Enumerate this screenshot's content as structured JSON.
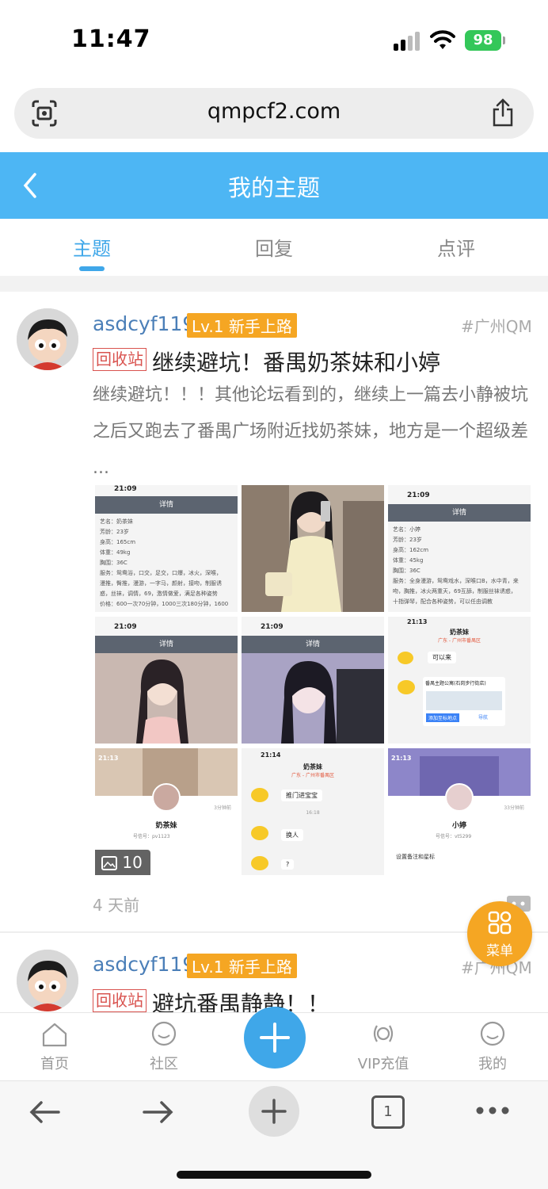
{
  "status": {
    "time": "11:47",
    "battery": "98"
  },
  "browser": {
    "url": "qmpcf2.com"
  },
  "header": {
    "title": "我的主题"
  },
  "tabs": [
    {
      "label": "主题"
    },
    {
      "label": "回复"
    },
    {
      "label": "点评"
    }
  ],
  "posts": [
    {
      "username": "asdcyf119",
      "level": "Lv.1 新手上路",
      "tag": "#广州QM",
      "category": "回收站",
      "title": "继续避坑！番禺奶茶妹和小婷",
      "excerpt": "继续避坑！！！其他论坛看到的，继续上一篇去小静被坑之后又跑去了番禺广场附近找奶茶妹，地方是一个超级差 ...",
      "image_count": "10",
      "time": "4 天前"
    },
    {
      "username": "asdcyf119",
      "level": "Lv.1 新手上路",
      "tag": "#广州QM",
      "category": "回收站",
      "title": "避坑番禺静静！！"
    }
  ],
  "images": {
    "img1": {
      "time": "21:09",
      "title": "详情",
      "lines": [
        "艺名：奶茶妹",
        "芳龄：23岁",
        "身高：165cm",
        "体重：49kg",
        "胸围：36C",
        "服务：鸳鸯浴，口交，足交，口爆，冰火，深喉，",
        "漫推，臀推，漫游，一字马，颜射，接吻，制服诱",
        "惑，丝袜，调情，69，激情做爱，满足各种姿势",
        "价格：600一次70分钟，1000三次180分钟，1600"
      ]
    },
    "img3": {
      "time": "21:09",
      "title": "详情",
      "lines": [
        "艺名：小婷",
        "芳龄：23岁",
        "身高：162cm",
        "体重：45kg",
        "胸围：36C",
        "服务：全身漫游，鸳鸯戏水，深喉口B，水中青，来",
        "吻，胸推，冰火两重天，69互舔，制服丝袜诱惑，",
        "十指弹琴，配合各种姿势，可以任由调教"
      ]
    },
    "img4": {
      "time": "21:09",
      "title": "详情"
    },
    "img5": {
      "time": "21:09",
      "title": "详情"
    },
    "img6": {
      "time": "21:13",
      "name": "奶茶妹",
      "loc": "广东 - 广州市番禺区",
      "msg": "可以来",
      "map": "番禺主题公寓(石岗步行街店)",
      "map_btn": "添加至标地点",
      "nav_btn": "导航"
    },
    "img7": {
      "time": "21:13",
      "name": "奶茶妹",
      "time_ago": "3分钟前",
      "id": "号信号：pv1123"
    },
    "img8": {
      "time": "21:14",
      "name": "奶茶妹",
      "loc": "广东 - 广州市番禺区",
      "msgs": [
        "推门进宝宝",
        "换人",
        "?"
      ],
      "stamp": "16:18"
    },
    "img9": {
      "time": "21:13",
      "name": "小婷",
      "time_ago": "33分钟前",
      "id": "号信号：vt5299",
      "setting": "设置备注和星标"
    }
  },
  "fab": {
    "label": "菜单"
  },
  "bottom_nav": [
    {
      "label": "首页"
    },
    {
      "label": "社区"
    },
    {
      "label": "VIP充值"
    },
    {
      "label": "我的"
    }
  ],
  "toolbar": {
    "tab_count": "1"
  },
  "colors": {
    "accent": "#3fa7e9",
    "header": "#4db6f4",
    "level": "#f5a623",
    "category": "#d9534f"
  }
}
